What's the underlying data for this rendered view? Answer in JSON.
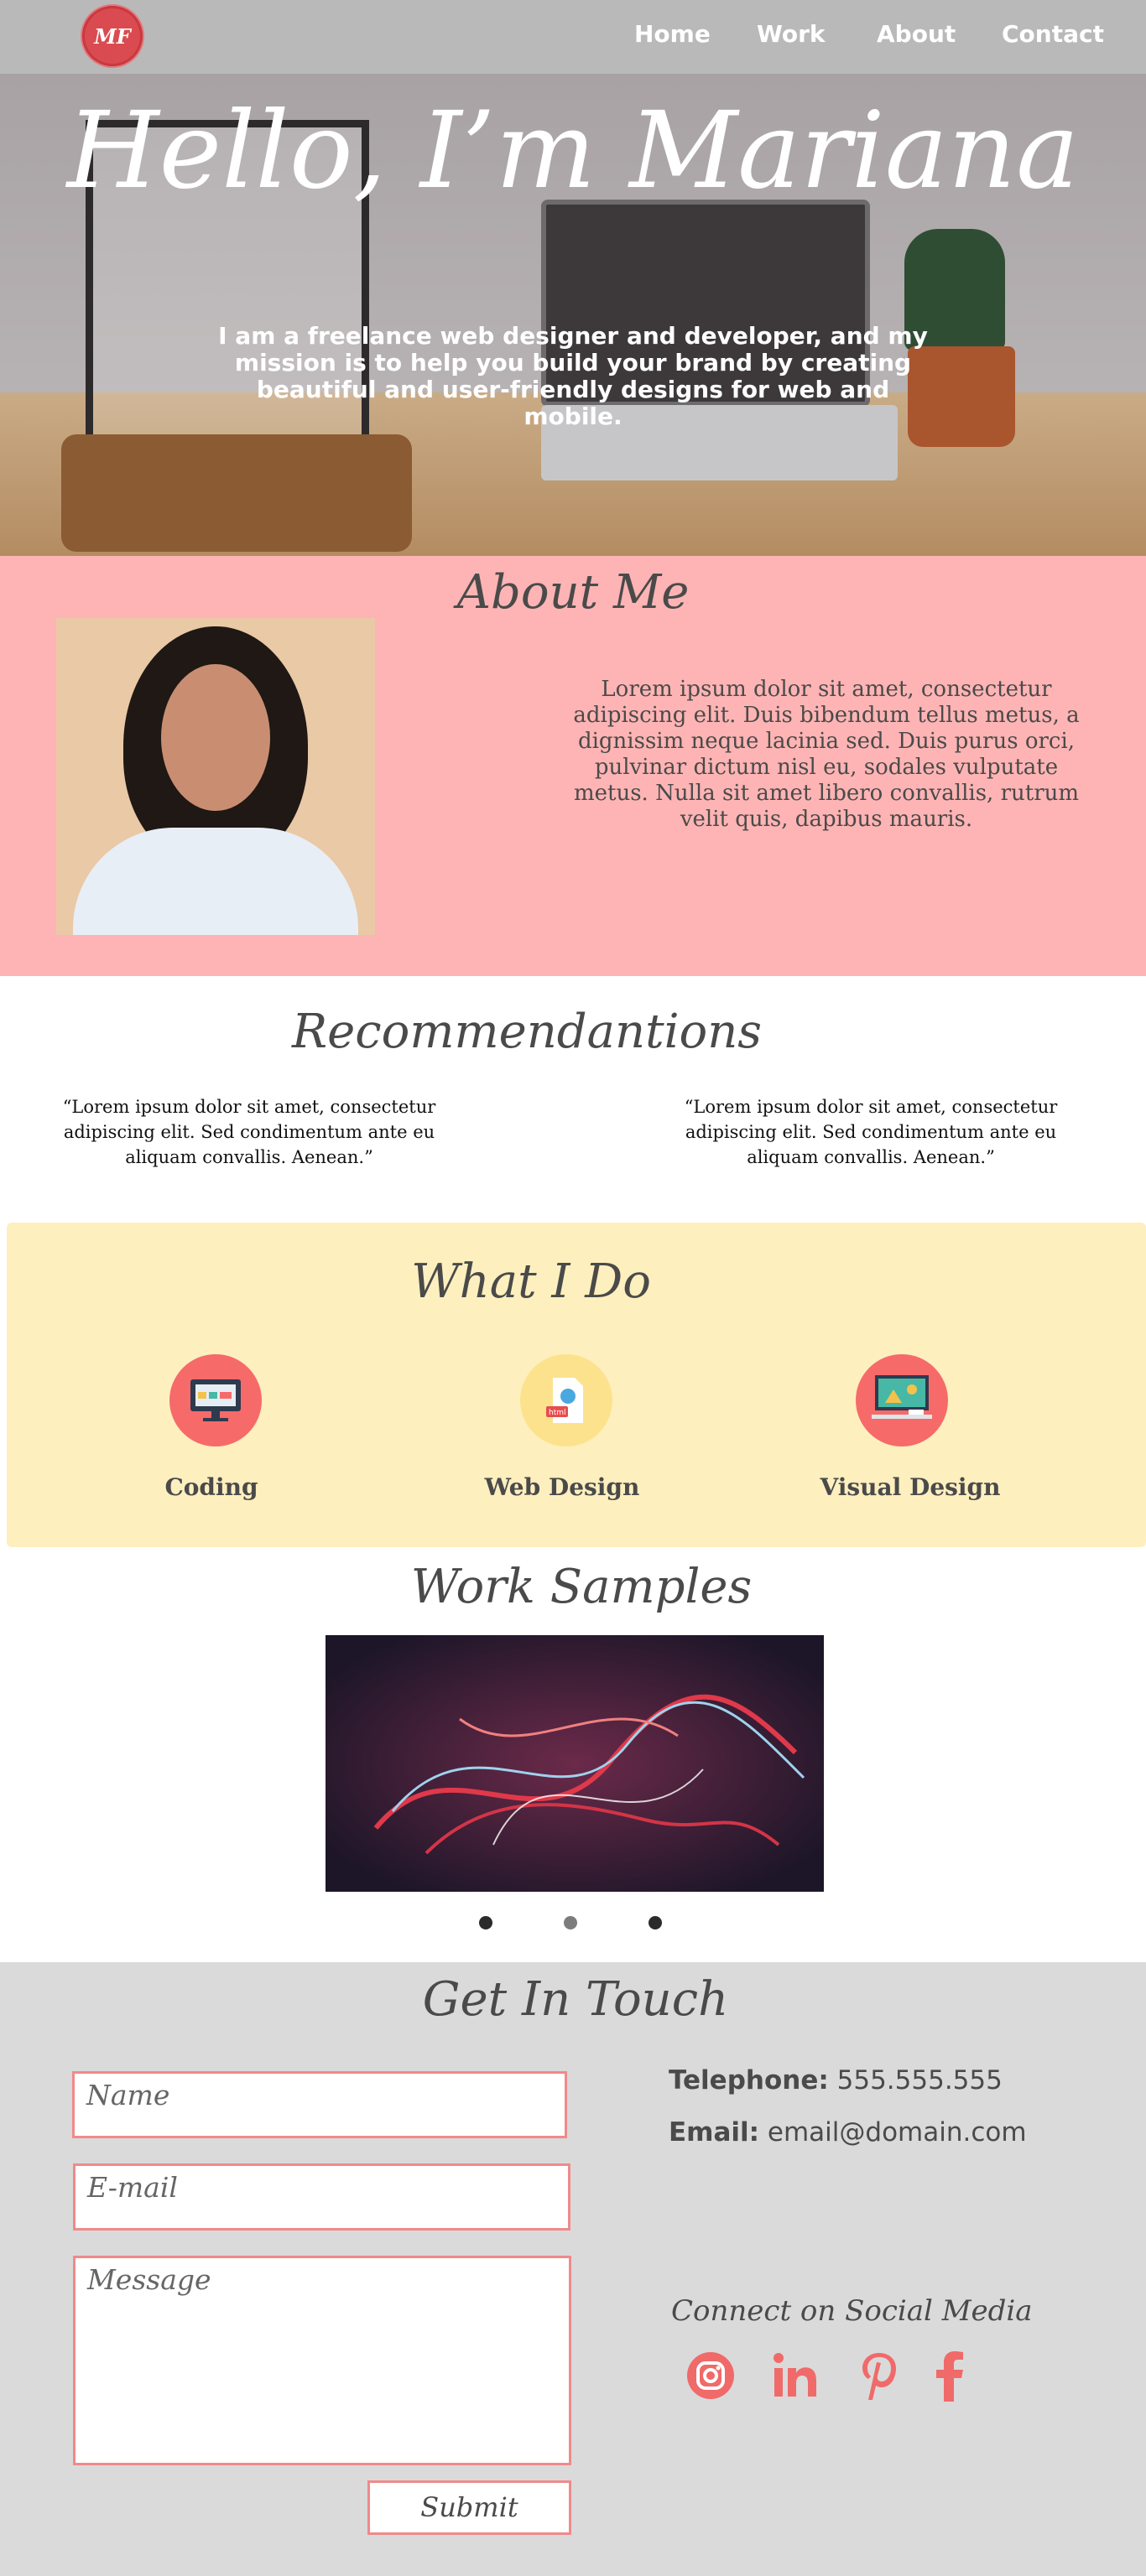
{
  "nav": {
    "logo_text": "MF",
    "links": [
      "Home",
      "Work",
      "About",
      "Contact"
    ]
  },
  "hero": {
    "title": "Hello, I’m Mariana",
    "text": "I am a freelance web designer and developer, and my mission is to help you build your brand by creating beautiful and user-friendly designs for web and mobile."
  },
  "about": {
    "title": "About Me",
    "text": "Lorem ipsum dolor sit amet, consectetur adipiscing elit. Duis bibendum tellus metus, a dignissim neque lacinia sed. Duis purus orci, pulvinar dictum nisl eu, sodales vulputate metus. Nulla sit amet libero convallis, rutrum velit quis, dapibus mauris."
  },
  "recommendations": {
    "title": "Recommendantions",
    "quotes": [
      "“Lorem ipsum dolor sit amet, consectetur adipiscing elit. Sed condimentum ante eu aliquam convallis. Aenean.”",
      "“Lorem ipsum dolor sit amet, consectetur adipiscing elit. Sed condimentum ante eu aliquam convallis. Aenean.”"
    ]
  },
  "services": {
    "title": "What I Do",
    "items": [
      {
        "label": "Coding",
        "icon": "monitor-icon"
      },
      {
        "label": "Web Design",
        "icon": "html-file-icon"
      },
      {
        "label": "Visual Design",
        "icon": "design-desk-icon"
      }
    ]
  },
  "work": {
    "title": "Work Samples",
    "carousel_dots": 3,
    "active_dot": 1
  },
  "contact": {
    "title": "Get In Touch",
    "name_placeholder": "Name",
    "email_placeholder": "E-mail",
    "message_placeholder": "Message",
    "submit_label": "Submit",
    "telephone_label": "Telephone:",
    "telephone_value": "555.555.555",
    "email_label": "Email:",
    "email_value": "email@domain.com",
    "social_title": "Connect on Social Media",
    "social_icons": [
      "instagram-icon",
      "linkedin-icon",
      "pinterest-icon",
      "facebook-icon"
    ]
  },
  "colors": {
    "nav_bg": "#b9b9b9",
    "about_bg": "#feb4b4",
    "services_bg": "#fdefbe",
    "contact_bg": "#dadada",
    "accent": "#f06a6a"
  }
}
